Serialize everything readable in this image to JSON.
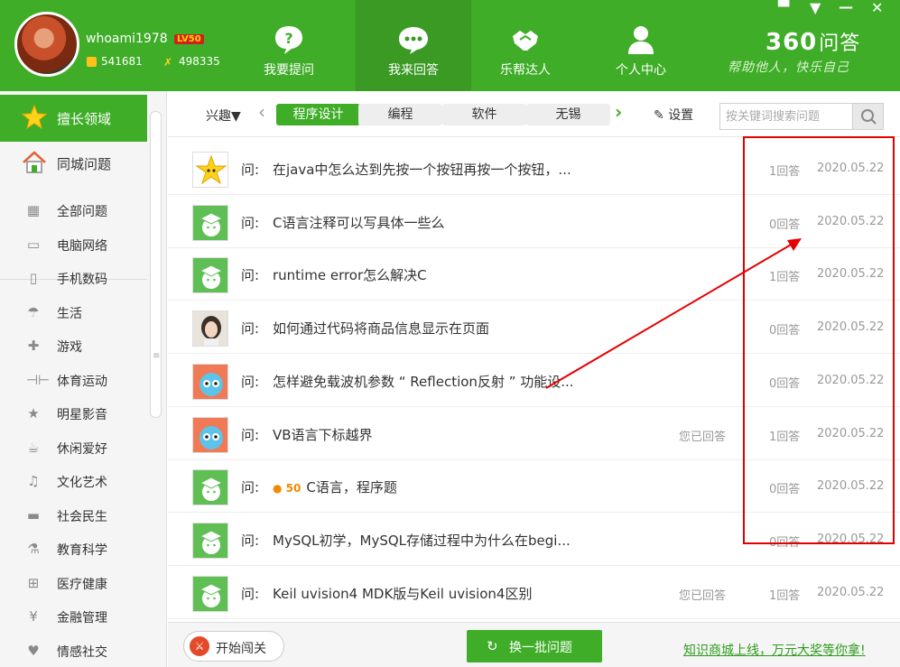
{
  "user": {
    "name": "whoami1978",
    "level_badge": "LV50",
    "coins": "541681",
    "experience": "498335"
  },
  "nav_tabs": [
    {
      "label": "我要提问",
      "icon": "question-bubble-icon"
    },
    {
      "label": "我来回答",
      "icon": "chat-bubble-icon",
      "active": true
    },
    {
      "label": "乐帮达人",
      "icon": "handshake-icon"
    },
    {
      "label": "个人中心",
      "icon": "person-icon"
    }
  ],
  "window_controls": {
    "feedback": "▀",
    "menu": "▼",
    "minimize": "—",
    "close": "✕"
  },
  "brand": {
    "logo_num": "360",
    "logo_text": "问答",
    "slogan": "帮助他人，快乐自己"
  },
  "sidebar": {
    "top_items": [
      {
        "label": "擅长领域",
        "icon": "star-icon",
        "active": true
      },
      {
        "label": "同城问题",
        "icon": "house-icon"
      }
    ],
    "items": [
      {
        "label": "全部问题",
        "icon": "grid-icon",
        "glyph": "▦"
      },
      {
        "label": "电脑网络",
        "icon": "monitor-icon",
        "glyph": "▭"
      },
      {
        "label": "手机数码",
        "icon": "phone-icon",
        "glyph": "▯"
      },
      {
        "label": "生活",
        "icon": "umbrella-icon",
        "glyph": "☂"
      },
      {
        "label": "游戏",
        "icon": "gamepad-icon",
        "glyph": "✚"
      },
      {
        "label": "体育运动",
        "icon": "dumbbell-icon",
        "glyph": "⊣⊢"
      },
      {
        "label": "明星影音",
        "icon": "star-outline-icon",
        "glyph": "★"
      },
      {
        "label": "休闲爱好",
        "icon": "cup-icon",
        "glyph": "☕"
      },
      {
        "label": "文化艺术",
        "icon": "music-note-icon",
        "glyph": "♫"
      },
      {
        "label": "社会民生",
        "icon": "speech-icon",
        "glyph": "▬"
      },
      {
        "label": "教育科学",
        "icon": "flask-icon",
        "glyph": "⚗"
      },
      {
        "label": "医疗健康",
        "icon": "medkit-icon",
        "glyph": "⊞"
      },
      {
        "label": "金融管理",
        "icon": "yen-icon",
        "glyph": "¥"
      },
      {
        "label": "情感社交",
        "icon": "heart-icon",
        "glyph": "♥"
      }
    ]
  },
  "filter": {
    "interest_label": "兴趣▼",
    "tags": [
      {
        "label": "程序设计",
        "active": true
      },
      {
        "label": "编程"
      },
      {
        "label": "软件"
      },
      {
        "label": "无锡"
      }
    ],
    "settings_label": "设置",
    "search_placeholder": "按关键词搜索问题"
  },
  "questions": [
    {
      "prefix": "问:",
      "title": "在java中怎么达到先按一个按钮再按一个按钮，...",
      "answered": "",
      "answers": "1回答",
      "date": "2020.05.22",
      "avatar": "star-character-avatar"
    },
    {
      "prefix": "问:",
      "title": "C语言注释可以写具体一些么",
      "answered": "",
      "answers": "0回答",
      "date": "2020.05.22",
      "avatar": "graduate-avatar"
    },
    {
      "prefix": "问:",
      "title": "runtime error怎么解决C",
      "answered": "",
      "answers": "1回答",
      "date": "2020.05.22",
      "avatar": "graduate-avatar"
    },
    {
      "prefix": "问:",
      "title": "如何通过代码将商品信息显示在页面",
      "answered": "",
      "answers": "0回答",
      "date": "2020.05.22",
      "avatar": "photo-avatar"
    },
    {
      "prefix": "问:",
      "title": "怎样避免载波机参数 “ Reflection反射 ” 功能设...",
      "answered": "",
      "answers": "0回答",
      "date": "2020.05.22",
      "avatar": "cartoon-avatar"
    },
    {
      "prefix": "问:",
      "title": "VB语言下标越界",
      "answered": "您已回答",
      "answers": "1回答",
      "date": "2020.05.22",
      "avatar": "cartoon-avatar"
    },
    {
      "prefix": "问:",
      "bounty": "50",
      "title": "C语言，程序题",
      "answered": "",
      "answers": "0回答",
      "date": "2020.05.22",
      "avatar": "graduate-avatar"
    },
    {
      "prefix": "问:",
      "title": "MySQL初学，MySQL存储过程中为什么在begi...",
      "answered": "",
      "answers": "0回答",
      "date": "2020.05.22",
      "avatar": "graduate-avatar"
    },
    {
      "prefix": "问:",
      "title": "Keil uvision4 MDK版与Keil uvision4区别",
      "answered": "您已回答",
      "answers": "1回答",
      "date": "2020.05.22",
      "avatar": "graduate-avatar"
    }
  ],
  "bottom": {
    "start_label": "开始闯关",
    "refresh_label": "换一批问题",
    "promo_link": "知识商城上线，万元大奖等你拿!"
  },
  "colors": {
    "brand_green": "#3fad28",
    "annotation_red": "#e50000"
  }
}
